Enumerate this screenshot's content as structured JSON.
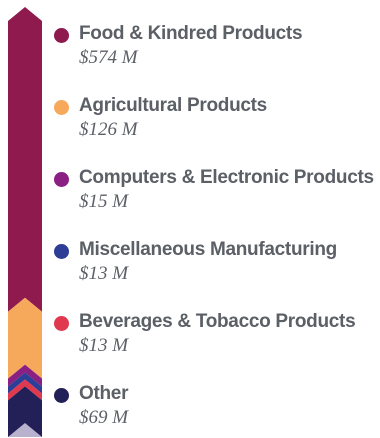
{
  "chart_data": {
    "type": "bar",
    "stacked": true,
    "orientation": "vertical",
    "categories": [
      "Food & Kindred Products",
      "Agricultural Products",
      "Computers & Electronic Products",
      "Miscellaneous Manufacturing",
      "Beverages & Tobacco Products",
      "Other"
    ],
    "series": [
      {
        "name": "Food & Kindred Products",
        "value": 574,
        "label": "$574 M",
        "color": "#8e1a4e"
      },
      {
        "name": "Agricultural Products",
        "value": 126,
        "label": "$126 M",
        "color": "#f7a95b"
      },
      {
        "name": "Computers & Electronic Products",
        "value": 15,
        "label": "$15 M",
        "color": "#8a2082"
      },
      {
        "name": "Miscellaneous Manufacturing",
        "value": 13,
        "label": "$13 M",
        "color": "#2c3e96"
      },
      {
        "name": "Beverages & Tobacco Products",
        "value": 13,
        "label": "$13 M",
        "color": "#e0384e"
      },
      {
        "name": "Other",
        "value": 69,
        "label": "$69 M",
        "color": "#222056"
      }
    ],
    "tip_color": "#b8b2cf",
    "legend_position": "right"
  }
}
